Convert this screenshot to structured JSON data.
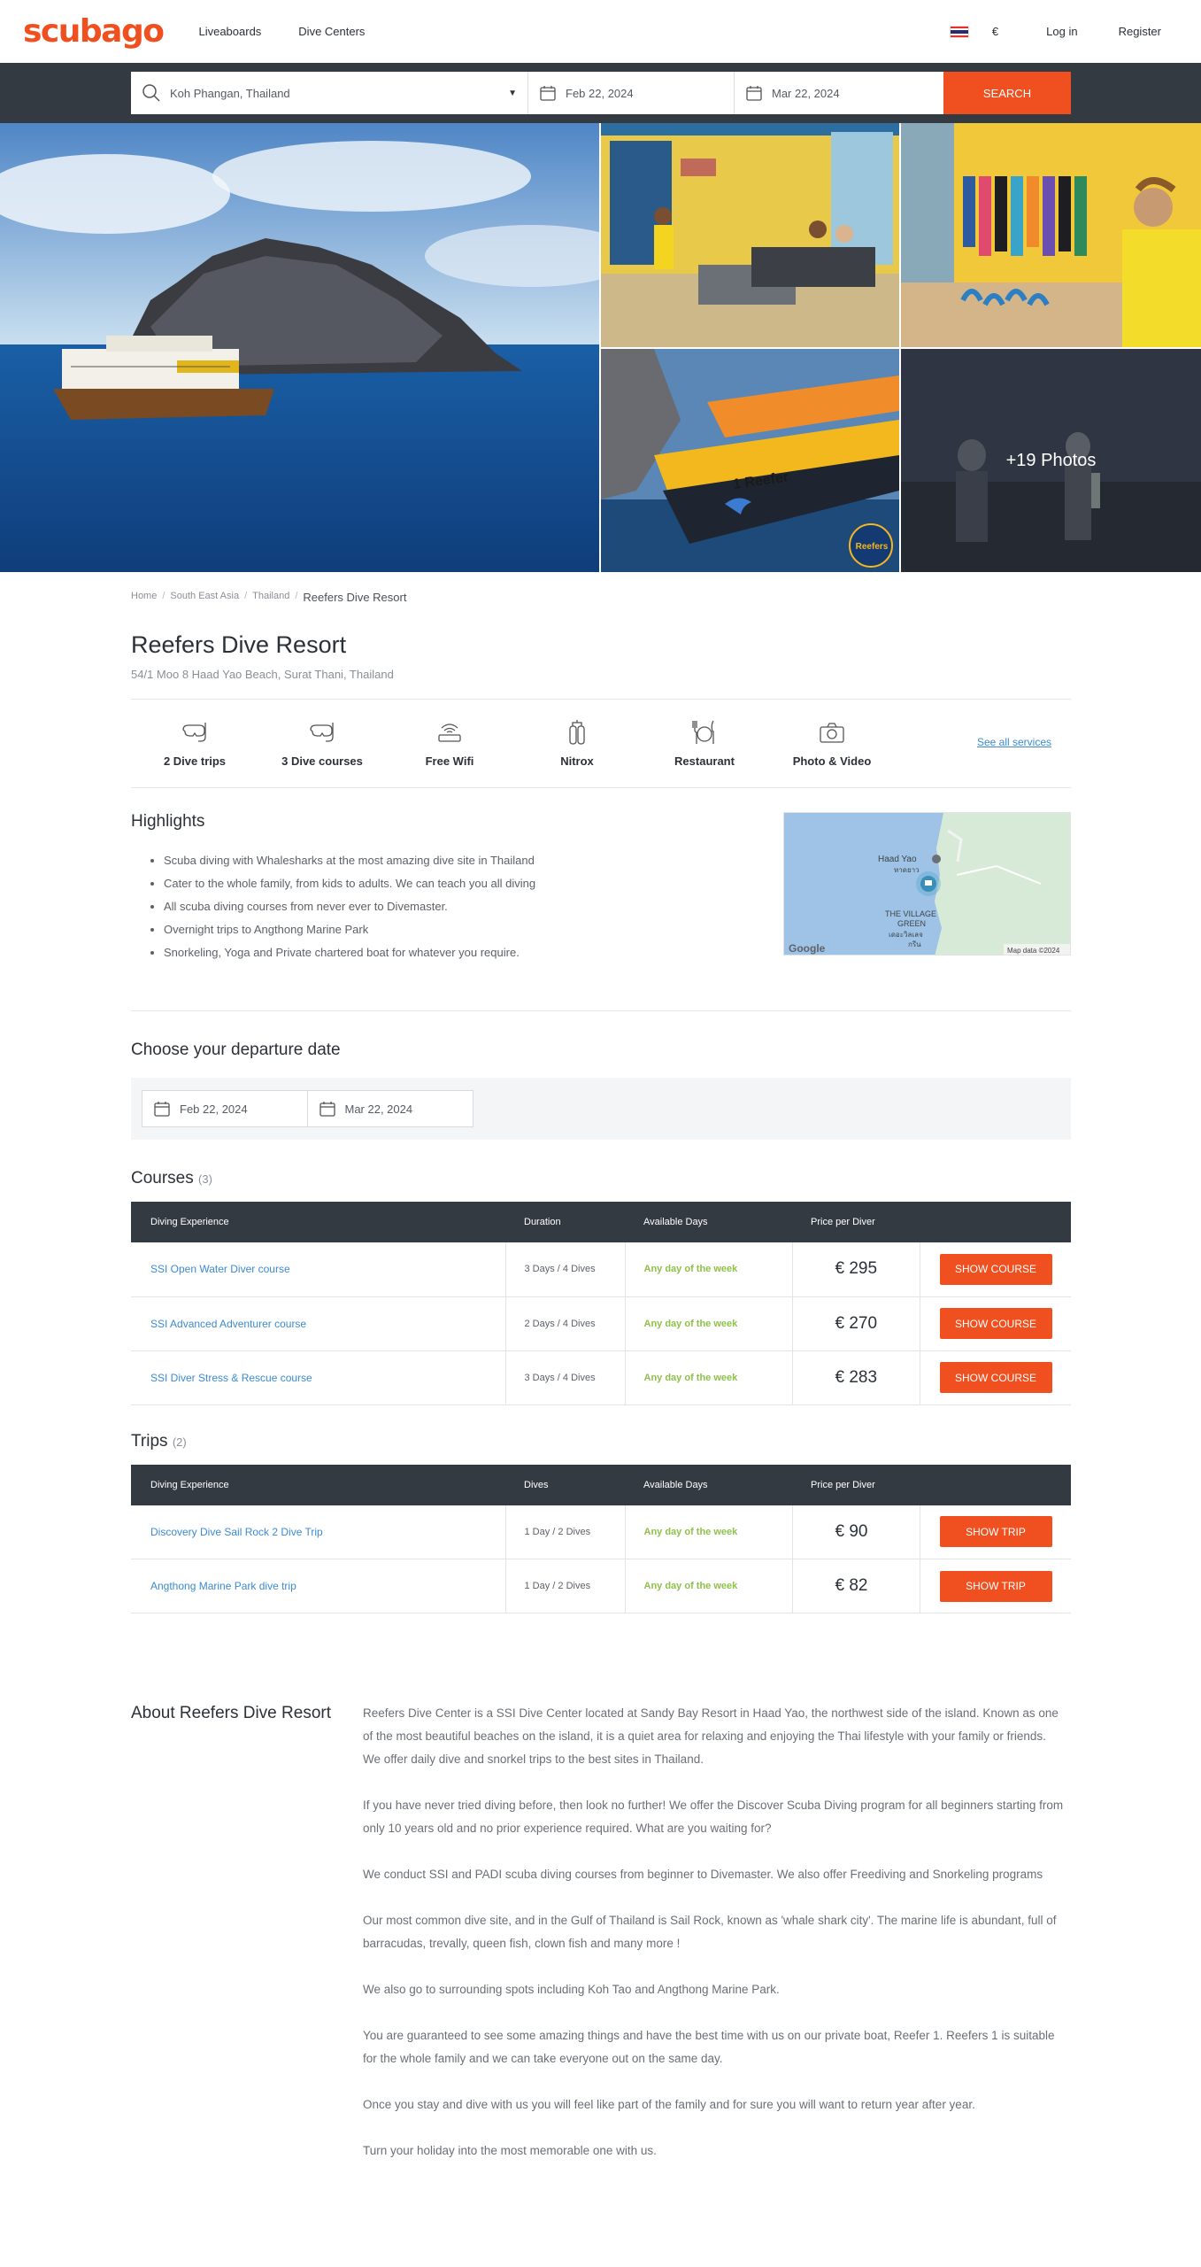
{
  "header": {
    "logo": "scubago",
    "nav": [
      "Liveaboards",
      "Dive Centers"
    ],
    "currency": "€",
    "login": "Log in",
    "register": "Register"
  },
  "search": {
    "location": "Koh Phangan, Thailand",
    "date_from": "Feb 22, 2024",
    "date_to": "Mar 22, 2024",
    "button": "SEARCH"
  },
  "gallery": {
    "more_photos": "+19 Photos",
    "boat_name": "1 Reefer",
    "logo_badge": "Reefers"
  },
  "breadcrumb": [
    "Home",
    "South East Asia",
    "Thailand",
    "Reefers Dive Resort"
  ],
  "resort": {
    "title": "Reefers Dive Resort",
    "address": "54/1 Moo 8 Haad Yao Beach, Surat Thani, Thailand"
  },
  "services": {
    "items": [
      {
        "label": "2 Dive trips",
        "icon": "snorkel-mask-icon"
      },
      {
        "label": "3 Dive courses",
        "icon": "snorkel-mask-icon"
      },
      {
        "label": "Free Wifi",
        "icon": "wifi-router-icon"
      },
      {
        "label": "Nitrox",
        "icon": "tank-icon"
      },
      {
        "label": "Restaurant",
        "icon": "cutlery-icon"
      },
      {
        "label": "Photo & Video",
        "icon": "camera-icon"
      }
    ],
    "see_all": "See all services"
  },
  "highlights": {
    "title": "Highlights",
    "items": [
      "Scuba diving with Whalesharks at the most amazing dive site in Thailand",
      "Cater to the whole family, from kids to adults. We can teach you all diving",
      "All scuba diving courses from never ever to Divemaster.",
      "Overnight trips to Angthong Marine Park",
      "Snorkeling, Yoga and Private chartered boat for whatever you require."
    ],
    "map": {
      "label_haad_yao": "Haad Yao",
      "label_haad_yao_th": "หาดยาว",
      "label_village": "THE VILLAGE",
      "label_green": "GREEN",
      "label_village_th": "เดอะวิลเลจ",
      "label_village_th2": "กรีน",
      "google": "Google",
      "attribution": "Map data ©2024"
    }
  },
  "departure": {
    "title": "Choose your departure date",
    "date_from": "Feb 22, 2024",
    "date_to": "Mar 22, 2024"
  },
  "courses": {
    "title": "Courses",
    "count": "(3)",
    "headers": [
      "Diving Experience",
      "Duration",
      "Available Days",
      "Price per Diver"
    ],
    "rows": [
      {
        "name": "SSI Open Water Diver course",
        "duration": "3 Days / 4 Dives",
        "days": "Any day of the week",
        "price": "€ 295",
        "button": "SHOW COURSE"
      },
      {
        "name": "SSI Advanced Adventurer course",
        "duration": "2 Days / 4 Dives",
        "days": "Any day of the week",
        "price": "€ 270",
        "button": "SHOW COURSE"
      },
      {
        "name": "SSI Diver Stress & Rescue course",
        "duration": "3 Days / 4 Dives",
        "days": "Any day of the week",
        "price": "€ 283",
        "button": "SHOW COURSE"
      }
    ]
  },
  "trips": {
    "title": "Trips",
    "count": "(2)",
    "headers": [
      "Diving Experience",
      "Dives",
      "Available Days",
      "Price per Diver"
    ],
    "rows": [
      {
        "name": "Discovery Dive Sail Rock 2 Dive Trip",
        "duration": "1 Day / 2 Dives",
        "days": "Any day of the week",
        "price": "€ 90",
        "button": "SHOW TRIP"
      },
      {
        "name": "Angthong Marine Park dive trip",
        "duration": "1 Day / 2 Dives",
        "days": "Any day of the week",
        "price": "€ 82",
        "button": "SHOW TRIP"
      }
    ]
  },
  "about": {
    "title": "About Reefers Dive Resort",
    "paragraphs": [
      "Reefers Dive Center is a SSI Dive Center located at Sandy Bay Resort in Haad Yao, the northwest side of the island. Known as one of the most beautiful beaches on the island, it is a quiet area for relaxing and enjoying the Thai lifestyle with your family or friends.",
      "We offer daily dive and snorkel trips to the best sites in Thailand.",
      "If you have never tried diving before, then look no further! We offer the Discover Scuba Diving program for all beginners starting from only 10 years old and no prior experience required. What are you waiting for?",
      "We conduct SSI and PADI scuba diving courses from beginner to Divemaster. We also offer Freediving and Snorkeling programs",
      "Our most common dive site, and in the Gulf of Thailand is Sail Rock, known as 'whale shark city'. The marine life is abundant, full of barracudas, trevally, queen fish, clown fish and many more !",
      "We also go to surrounding spots including Koh Tao and Angthong Marine Park.",
      "You are guaranteed to see some amazing things and have the best time with us on our private boat, Reefer 1. Reefers 1 is suitable for the whole family and we can take everyone out on the same day.",
      "Once you stay and dive with us you will feel like part of the family and for sure you will want to return year after year.",
      "Turn your holiday into the most memorable one with us."
    ]
  }
}
